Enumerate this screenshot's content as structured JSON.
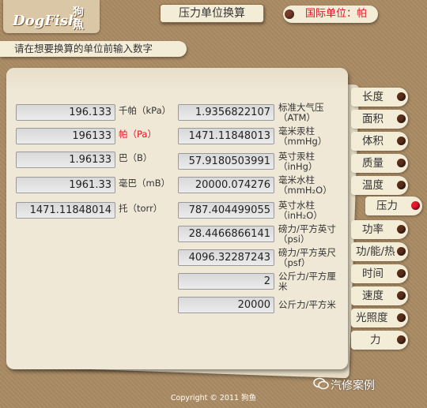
{
  "logo": {
    "en": "DogFish",
    "cn": "狗魚"
  },
  "title": "压力单位换算",
  "si_unit": "国际单位：帕",
  "instruction": "请在想要换算的单位前输入数字",
  "left_fields": [
    {
      "value": "196.133",
      "unit": "千帕（kPa）"
    },
    {
      "value": "196133",
      "unit": "帕（Pa）"
    },
    {
      "value": "1.96133",
      "unit": "巴（B）"
    },
    {
      "value": "1961.33",
      "unit": "毫巴（mB）"
    },
    {
      "value": "1471.11848014",
      "unit": "托（torr）"
    }
  ],
  "right_fields": [
    {
      "value": "1.9356822107",
      "unit": [
        "标准大气压",
        "（ATM）"
      ]
    },
    {
      "value": "1471.11848013",
      "unit": [
        "毫米汞柱",
        "（mmHg）"
      ]
    },
    {
      "value": "57.9180503991",
      "unit": [
        "英寸汞柱",
        "（inHg）"
      ]
    },
    {
      "value": "20000.074276",
      "unit": [
        "毫米水柱",
        "（mmH₂O）"
      ]
    },
    {
      "value": "787.404499055",
      "unit": [
        "英寸水柱",
        "（inH₂O）"
      ]
    },
    {
      "value": "28.4466866141",
      "unit": [
        "磅力/平方英寸",
        "（psi）"
      ]
    },
    {
      "value": "4096.32287243",
      "unit": [
        "磅力/平方英尺",
        "（psf）"
      ]
    },
    {
      "value": "2",
      "unit": [
        "公斤力/平方厘",
        "米"
      ]
    },
    {
      "value": "20000",
      "unit": [
        "公斤力/平方米",
        ""
      ]
    }
  ],
  "tabs": [
    "长度",
    "面积",
    "体积",
    "质量",
    "温度",
    "压力",
    "功率",
    "功/能/热",
    "时间",
    "速度",
    "光照度",
    "力"
  ],
  "active_tab": "压力",
  "footer": "Copyright © 2011  狗鱼",
  "watermark": "汽修案例",
  "colors": {
    "active": "#e5182c",
    "background": "#a98a63",
    "paper": "#efe8d6"
  }
}
